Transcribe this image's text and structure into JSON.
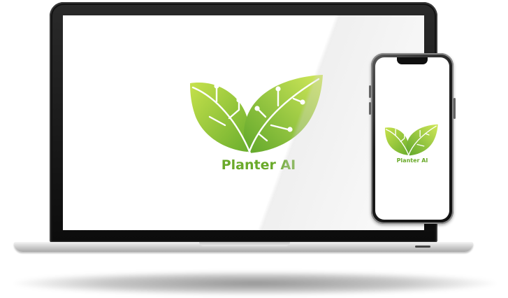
{
  "app": {
    "brand_name": "Planter AI"
  },
  "colors": {
    "leaf_light": "#c6e14c",
    "leaf_dark": "#6aae2d",
    "brand_text": "#6aaa2a",
    "device_frame": "#111111",
    "device_silver": "#d5d5d5"
  },
  "icons": {
    "logo": "leaf-circuit-icon"
  }
}
